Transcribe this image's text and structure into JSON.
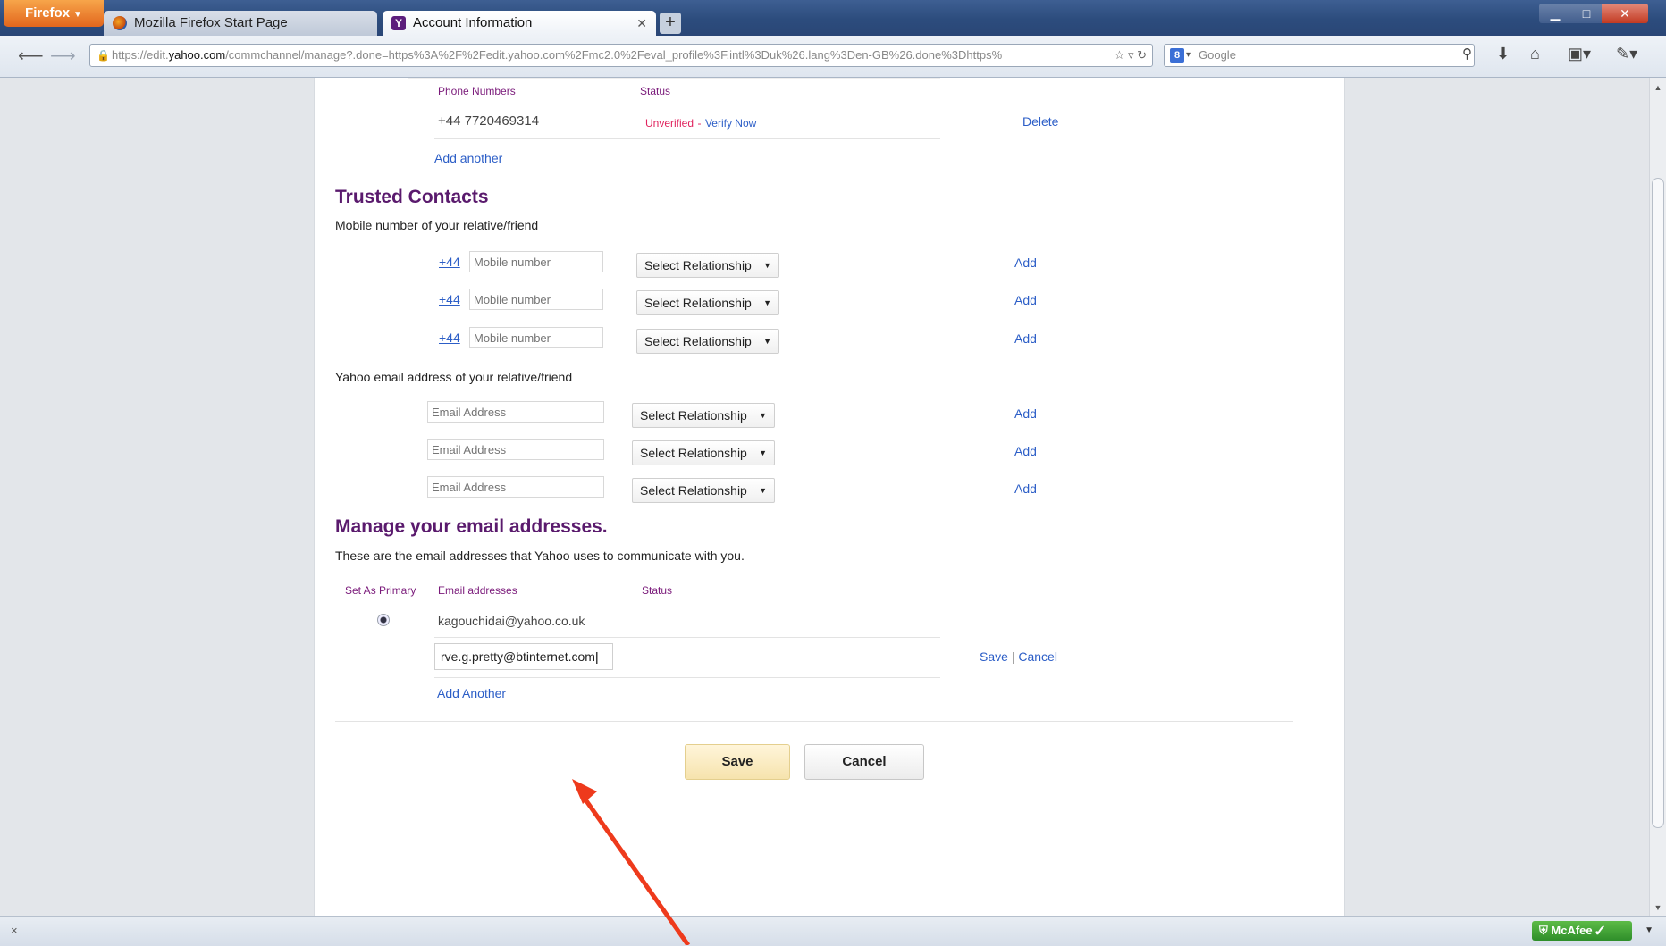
{
  "browser": {
    "firefox_button": "Firefox",
    "tabs": [
      {
        "title": "Mozilla Firefox Start Page",
        "active": false
      },
      {
        "title": "Account Information",
        "active": true
      }
    ],
    "new_tab": "+",
    "url": {
      "prefix": "https://edit.",
      "host": "yahoo.com",
      "rest": "/commchannel/manage?.done=https%3A%2F%2Fedit.yahoo.com%2Fmc2.0%2Feval_profile%3F.intl%3Duk%26.lang%3Den-GB%26.done%3Dhttps%"
    },
    "search_engine": "Google",
    "search_placeholder": "Google"
  },
  "phones": {
    "header_number": "Phone Numbers",
    "header_status": "Status",
    "items": [
      {
        "number": "+44 7720469314",
        "status": "Unverified",
        "separator": "-",
        "verify": "Verify Now",
        "delete": "Delete"
      }
    ],
    "add_another": "Add another"
  },
  "trusted_contacts": {
    "title": "Trusted Contacts",
    "mobile_label": "Mobile number of your relative/friend",
    "mobile_rows": [
      {
        "country_code": "+44",
        "placeholder": "Mobile number",
        "relationship": "Select Relationship",
        "action": "Add"
      },
      {
        "country_code": "+44",
        "placeholder": "Mobile number",
        "relationship": "Select Relationship",
        "action": "Add"
      },
      {
        "country_code": "+44",
        "placeholder": "Mobile number",
        "relationship": "Select Relationship",
        "action": "Add"
      }
    ],
    "email_label": "Yahoo email address of your relative/friend",
    "email_rows": [
      {
        "placeholder": "Email Address",
        "relationship": "Select Relationship",
        "action": "Add"
      },
      {
        "placeholder": "Email Address",
        "relationship": "Select Relationship",
        "action": "Add"
      },
      {
        "placeholder": "Email Address",
        "relationship": "Select Relationship",
        "action": "Add"
      }
    ]
  },
  "manage_email": {
    "title": "Manage your email addresses.",
    "description": "These are the email addresses that Yahoo uses to communicate with you.",
    "header_primary": "Set As Primary",
    "header_email": "Email addresses",
    "header_status": "Status",
    "primary_email": "kagouchidai@yahoo.co.uk",
    "new_email_value": "rve.g.pretty@btinternet.com",
    "save_link": "Save",
    "link_separator": "|",
    "cancel_link": "Cancel",
    "add_another": "Add Another"
  },
  "buttons": {
    "save": "Save",
    "cancel": "Cancel"
  },
  "statusbar": {
    "close_glyph": "×",
    "mcafee": "McAfee"
  },
  "colors": {
    "accent_purple": "#5a1a6d",
    "link_blue": "#2c5ec7",
    "unverified_pink": "#e0245e",
    "annotation_arrow": "#ee3a1c"
  }
}
